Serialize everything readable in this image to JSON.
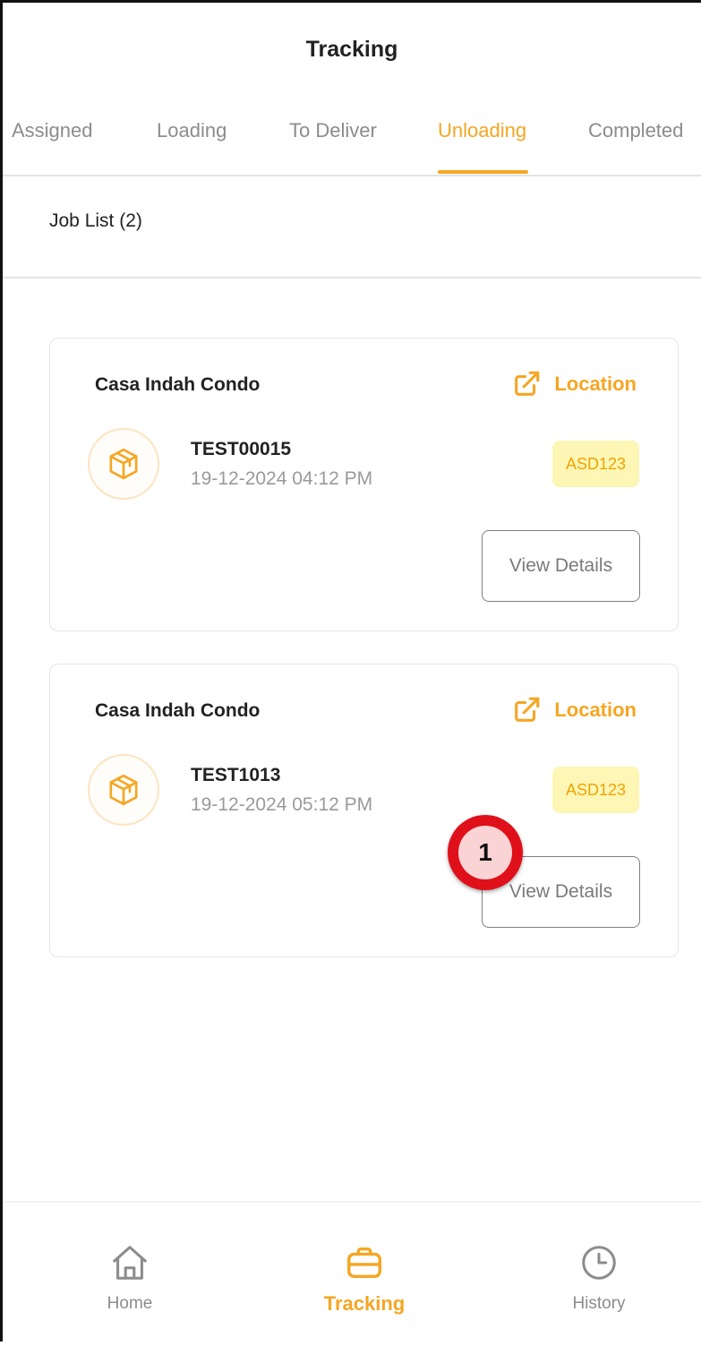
{
  "header": {
    "title": "Tracking"
  },
  "tabs": [
    {
      "label": "Assigned",
      "active": false
    },
    {
      "label": "Loading",
      "active": false
    },
    {
      "label": "To Deliver",
      "active": false
    },
    {
      "label": "Unloading",
      "active": true
    },
    {
      "label": "Completed",
      "active": false
    }
  ],
  "job_list": {
    "title": "Job List (2)",
    "jobs": [
      {
        "place": "Casa Indah Condo",
        "location_label": "Location",
        "code": "TEST00015",
        "datetime": "19-12-2024 04:12 PM",
        "plate": "ASD123",
        "view_label": "View Details"
      },
      {
        "place": "Casa Indah Condo",
        "location_label": "Location",
        "code": "TEST1013",
        "datetime": "19-12-2024 05:12 PM",
        "plate": "ASD123",
        "view_label": "View Details"
      }
    ]
  },
  "annotation": {
    "number": "1"
  },
  "bottom_nav": [
    {
      "label": "Home",
      "icon": "home-icon",
      "active": false
    },
    {
      "label": "Tracking",
      "icon": "briefcase-icon",
      "active": true
    },
    {
      "label": "History",
      "icon": "clock-icon",
      "active": false
    }
  ],
  "colors": {
    "accent": "#f5a623",
    "text": "#222222",
    "muted": "#8c8c8c",
    "badge_bg": "#fdf6b5",
    "callout": "#e0101a"
  }
}
